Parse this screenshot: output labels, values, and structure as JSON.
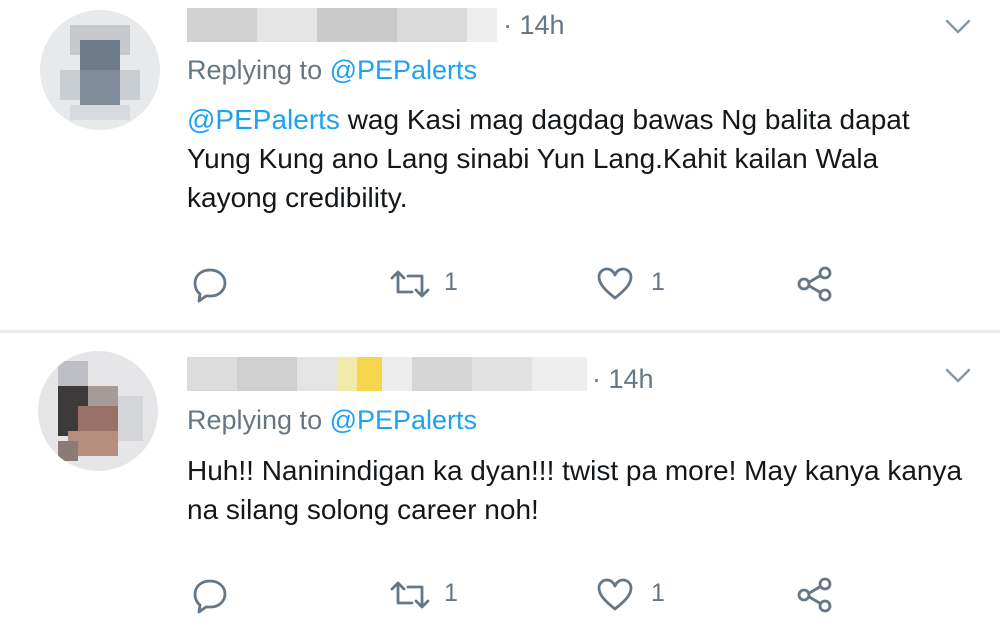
{
  "tweets": [
    {
      "time": "· 14h",
      "replying_prefix": "Replying to ",
      "replying_handle": "@PEPalerts",
      "mention": "@PEPalerts",
      "text": " wag Kasi mag dagdag bawas Ng balita dapat Yung Kung ano Lang sinabi Yun Lang.Kahit kailan Wala kayong credibility.",
      "retweet_count": "1",
      "like_count": "1"
    },
    {
      "time": "· 14h",
      "replying_prefix": "Replying to ",
      "replying_handle": "@PEPalerts",
      "mention": "",
      "text": "Huh!! Naninindigan ka dyan!!! twist pa more! May kanya kanya na silang solong career noh!",
      "retweet_count": "1",
      "like_count": "1"
    }
  ],
  "icons": {
    "reply": "reply-icon",
    "retweet": "retweet-icon",
    "like": "heart-icon",
    "share": "share-icon",
    "menu": "chevron-down-icon"
  },
  "colors": {
    "link": "#1da1f2",
    "secondary_text": "#657786",
    "primary_text": "#14171a",
    "divider": "#e6ecf0"
  }
}
